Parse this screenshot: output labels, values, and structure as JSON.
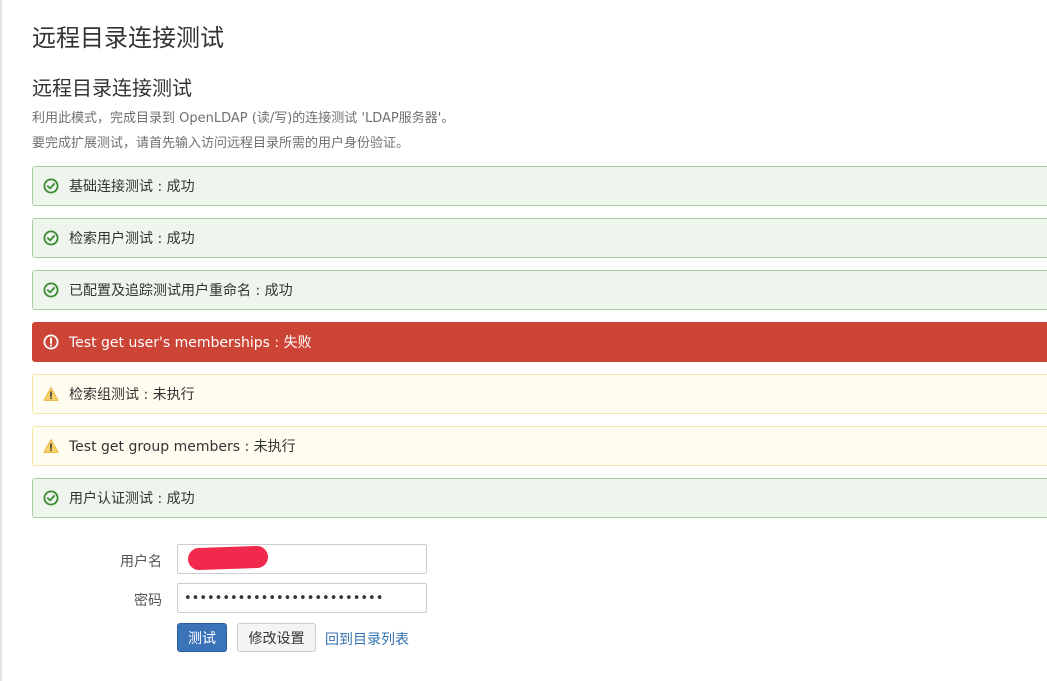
{
  "page": {
    "title": "远程目录连接测试"
  },
  "section": {
    "title": "远程目录连接测试",
    "desc_line1": "利用此模式，完成目录到 OpenLDAP (读/写)的连接测试 'LDAP服务器'。",
    "desc_line2": "要完成扩展测试，请首先输入访问远程目录所需的用户身份验证。"
  },
  "results": [
    {
      "label": "基础连接测试 : 成功",
      "status": "success",
      "icon": "check-circle-icon"
    },
    {
      "label": "检索用户测试 : 成功",
      "status": "success",
      "icon": "check-circle-icon"
    },
    {
      "label": "已配置及追踪测试用户重命名 : 成功",
      "status": "success",
      "icon": "check-circle-icon"
    },
    {
      "label": "Test get user's memberships : 失败",
      "status": "error",
      "icon": "exclamation-circle-icon"
    },
    {
      "label": "检索组测试 : 未执行",
      "status": "warning",
      "icon": "warning-triangle-icon"
    },
    {
      "label": "Test get group members : 未执行",
      "status": "warning",
      "icon": "warning-triangle-icon"
    },
    {
      "label": "用户认证测试 : 成功",
      "status": "success",
      "icon": "check-circle-icon"
    }
  ],
  "form": {
    "username_label": "用户名",
    "username_value": "",
    "password_label": "密码",
    "password_value": "••••••••••••••••••••••••••"
  },
  "actions": {
    "test_button": "测试",
    "edit_button": "修改设置",
    "back_link": "回到目录列表"
  },
  "colors": {
    "success_bg": "#eef5ec",
    "error_bg": "#cc4436",
    "warning_bg": "#fffcf0",
    "success_icon": "#3a8a2f",
    "warning_icon": "#e8b43a",
    "primary_button": "#3b73b9",
    "link": "#3572b0"
  }
}
